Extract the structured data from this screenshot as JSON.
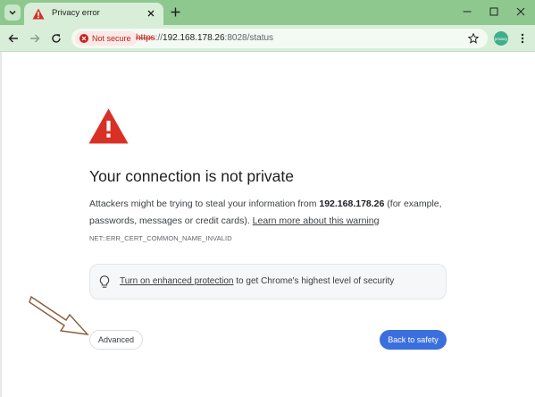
{
  "browser": {
    "tab": {
      "title": "Privacy error",
      "favicon": "warning-icon"
    },
    "address_bar": {
      "security_chip": "Not secure",
      "url_scheme": "https",
      "url_separator": "://",
      "url_host": "192.168.178.26",
      "url_path": ":8028/status"
    },
    "profile_label": "privacy",
    "colors": {
      "frame": "#8fc88f",
      "toolbar": "#d8eed8",
      "danger": "#c5221f"
    }
  },
  "interstitial": {
    "heading": "Your connection is not private",
    "body_prefix": "Attackers might be trying to steal your information from ",
    "body_host": "192.168.178.26",
    "body_suffix": " (for example, passwords, messages or credit cards). ",
    "learn_more_link": "Learn more about this warning",
    "error_code": "NET::ERR_CERT_COMMON_NAME_INVALID",
    "protection": {
      "link": "Turn on enhanced protection",
      "rest": " to get Chrome's highest level of security"
    },
    "advanced_button": "Advanced",
    "back_button": "Back to safety",
    "colors": {
      "warning": "#d93025",
      "primary_button": "#3b6fde"
    }
  }
}
